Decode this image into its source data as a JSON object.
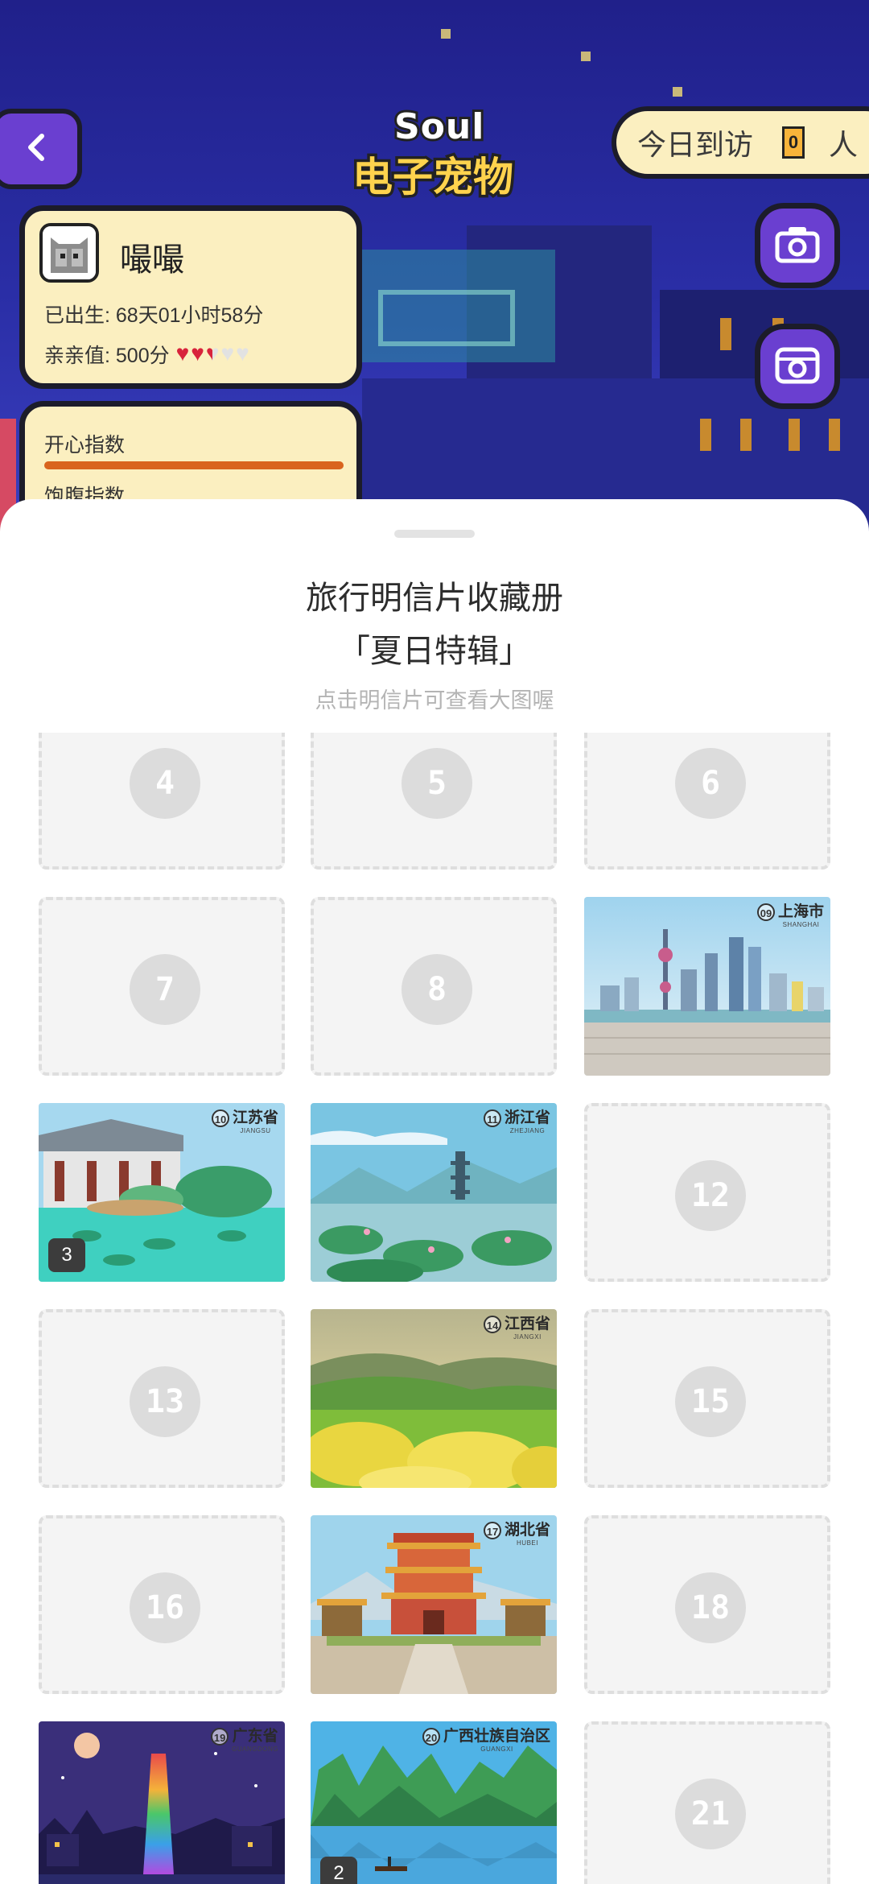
{
  "header": {
    "logo_line1": "Soul",
    "logo_line2": "电子宠物",
    "visitor_label": "今日到访",
    "visitor_count": "0",
    "visitor_unit": "人"
  },
  "pet": {
    "name": "嘬嘬",
    "born": "已出生: 68天01小时58分",
    "affinity": "亲亲值: 500分",
    "hearts_full": 2.5,
    "hearts_total": 5
  },
  "stats": [
    {
      "label": "开心指数",
      "level": 1.0
    },
    {
      "label": "饱腹指数",
      "level": null
    }
  ],
  "sheet": {
    "title_line1": "旅行明信片收藏册",
    "title_line2": "「夏日特辑」",
    "hint": "点击明信片可查看大图喔"
  },
  "postcards": [
    {
      "num": "4",
      "collected": false
    },
    {
      "num": "5",
      "collected": false
    },
    {
      "num": "6",
      "collected": false
    },
    {
      "num": "7",
      "collected": false
    },
    {
      "num": "8",
      "collected": false
    },
    {
      "num": "09",
      "collected": true,
      "name": "上海市",
      "en": "SHANGHAI",
      "scene": "shanghai"
    },
    {
      "num": "10",
      "collected": true,
      "name": "江苏省",
      "en": "JIANGSU",
      "scene": "jiangsu",
      "count": "3"
    },
    {
      "num": "11",
      "collected": true,
      "name": "浙江省",
      "en": "ZHEJIANG",
      "scene": "zhejiang"
    },
    {
      "num": "12",
      "collected": false
    },
    {
      "num": "13",
      "collected": false
    },
    {
      "num": "14",
      "collected": true,
      "name": "江西省",
      "en": "JIANGXI",
      "scene": "jiangxi"
    },
    {
      "num": "15",
      "collected": false
    },
    {
      "num": "16",
      "collected": false
    },
    {
      "num": "17",
      "collected": true,
      "name": "湖北省",
      "en": "HUBEI",
      "scene": "hubei"
    },
    {
      "num": "18",
      "collected": false
    },
    {
      "num": "19",
      "collected": true,
      "name": "广东省",
      "en": "GUANGDONG",
      "scene": "guangdong"
    },
    {
      "num": "20",
      "collected": true,
      "name": "广西壮族自治区",
      "en": "GUANGXI",
      "scene": "guangxi",
      "count": "2"
    },
    {
      "num": "21",
      "collected": false
    }
  ],
  "colors": {
    "accent_purple": "#6a3fd0",
    "card_cream": "#fbefc0",
    "heart_red": "#d8233b"
  }
}
